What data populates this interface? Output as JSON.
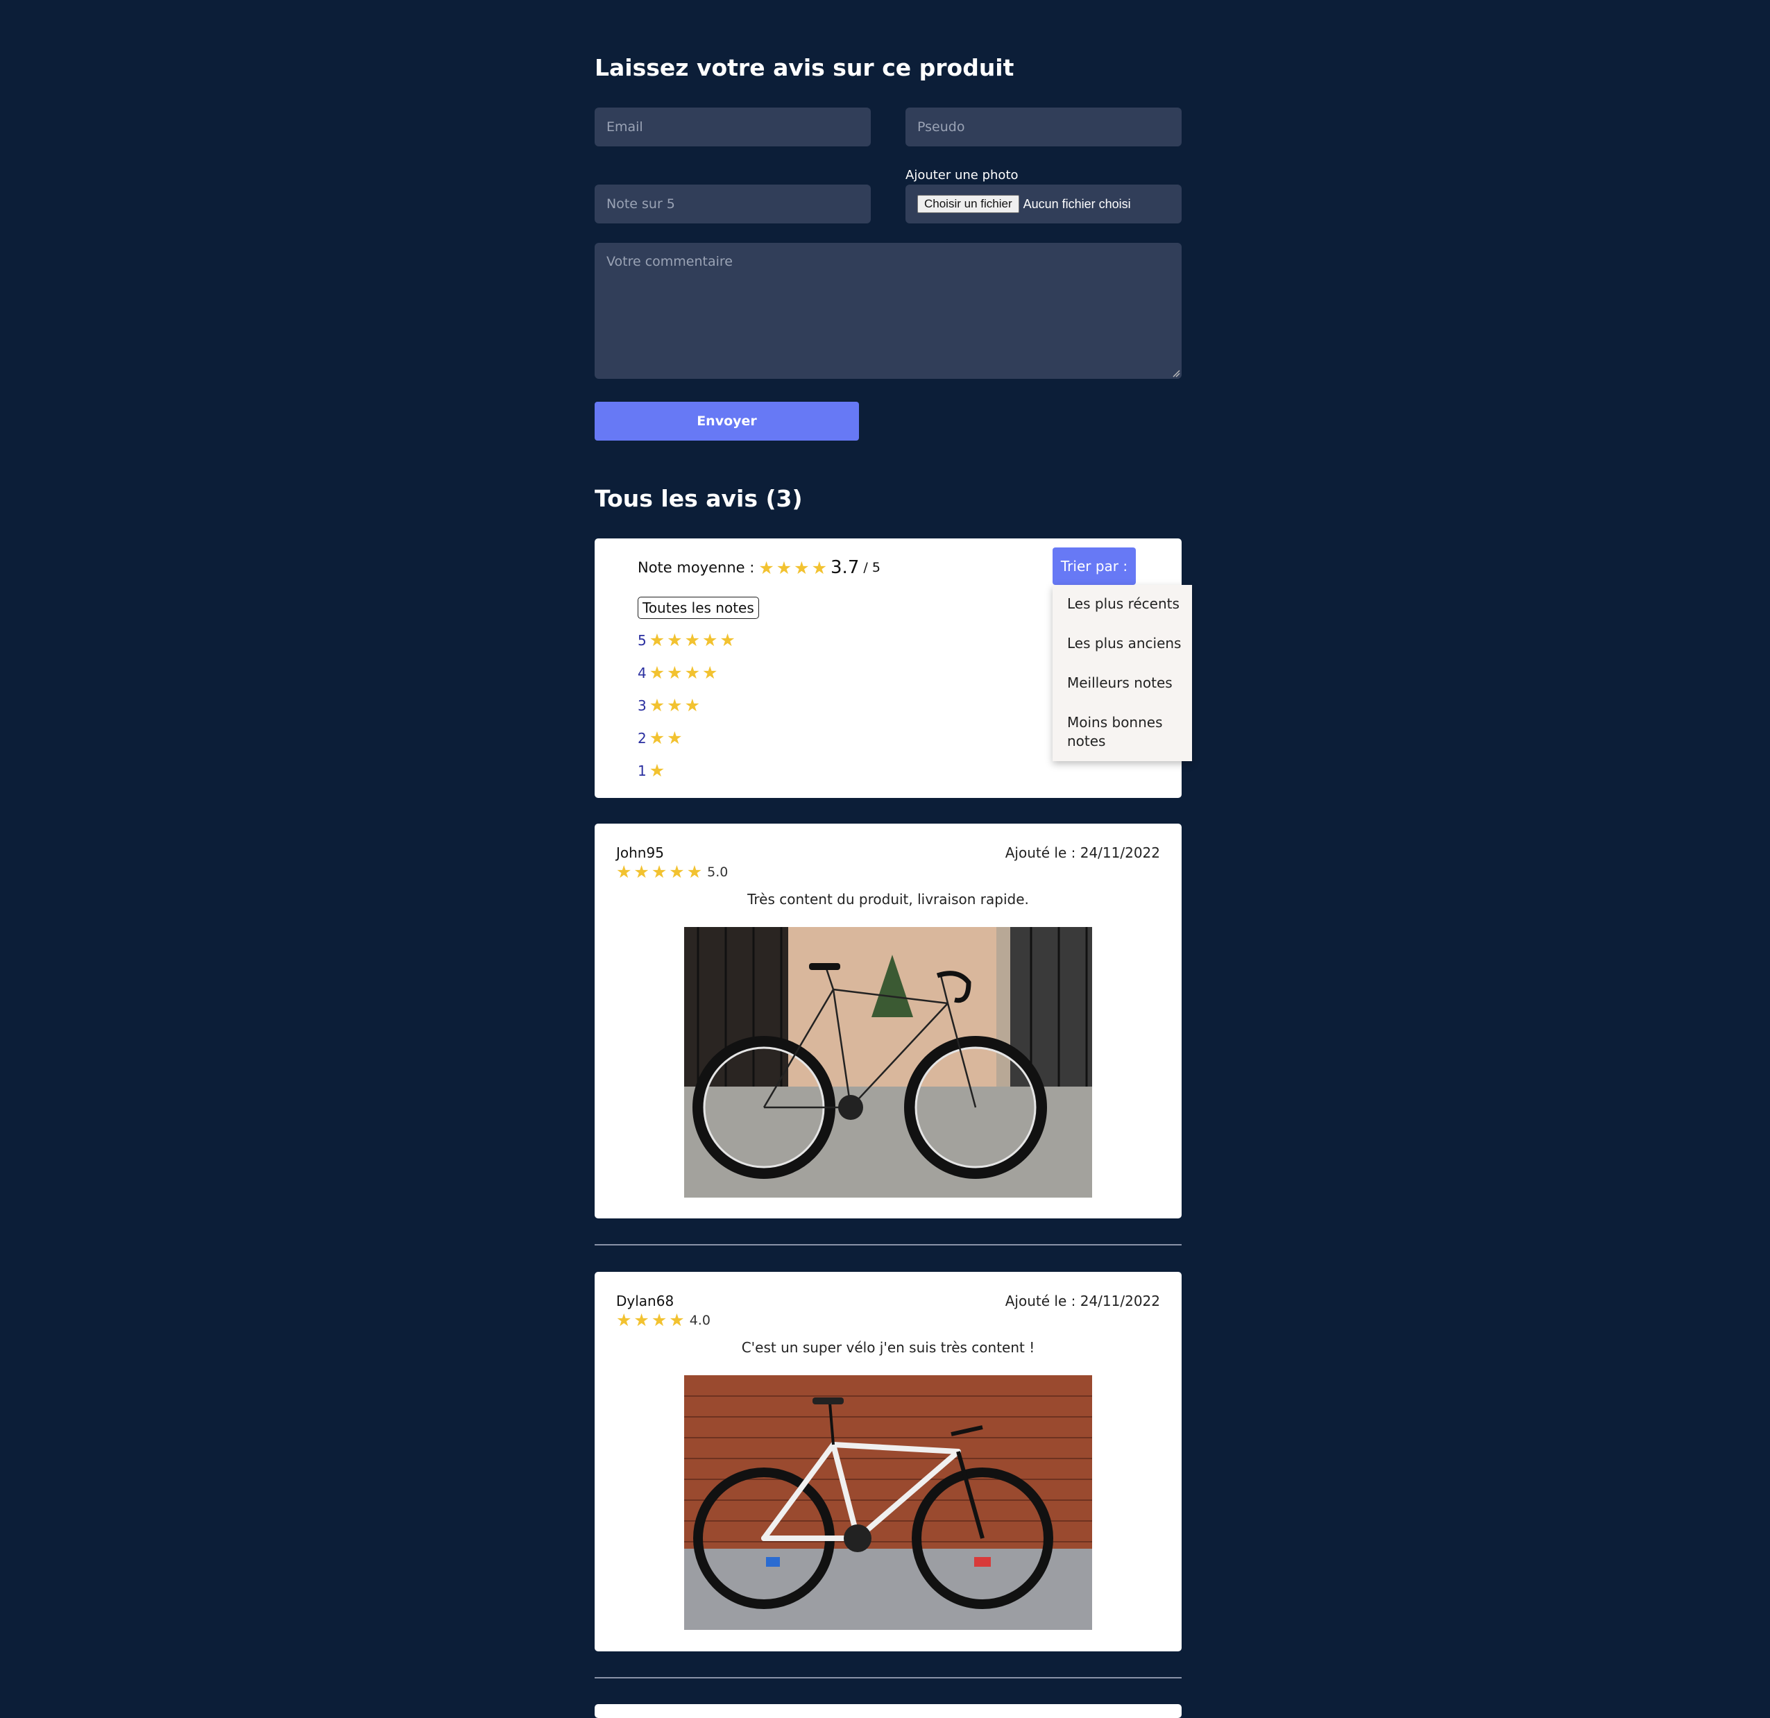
{
  "form": {
    "title": "Laissez votre avis sur ce produit",
    "email_placeholder": "Email",
    "pseudo_placeholder": "Pseudo",
    "note_placeholder": "Note sur 5",
    "photo_label": "Ajouter une photo",
    "file_button": "Choisir un fichier",
    "file_status": "Aucun fichier choisi",
    "comment_placeholder": "Votre commentaire",
    "submit_label": "Envoyer"
  },
  "reviews_section": {
    "title": "Tous les avis (3)",
    "average_label": "Note moyenne :",
    "average_value": "3.7",
    "average_max": "/ 5",
    "filter_all": "Toutes les notes",
    "rating_levels": [
      "5",
      "4",
      "3",
      "2",
      "1"
    ],
    "sort_label": "Trier par :",
    "sort_options": [
      "Les plus récents",
      "Les plus anciens",
      "Meilleurs notes",
      "Moins bonnes\nnotes"
    ]
  },
  "reviews": [
    {
      "author": "John95",
      "rating": "5.0",
      "date_label": "Ajouté le : 24/11/2022",
      "comment": "Très content du produit, livraison rapide."
    },
    {
      "author": "Dylan68",
      "rating": "4.0",
      "date_label": "Ajouté le : 24/11/2022",
      "comment": "C'est un super vélo j'en suis très content !"
    }
  ],
  "colors": {
    "background": "#0c1e38",
    "input_bg": "#313e59",
    "accent": "#6779f5",
    "star": "#f2c230"
  },
  "icons": {
    "star": "star-icon"
  }
}
